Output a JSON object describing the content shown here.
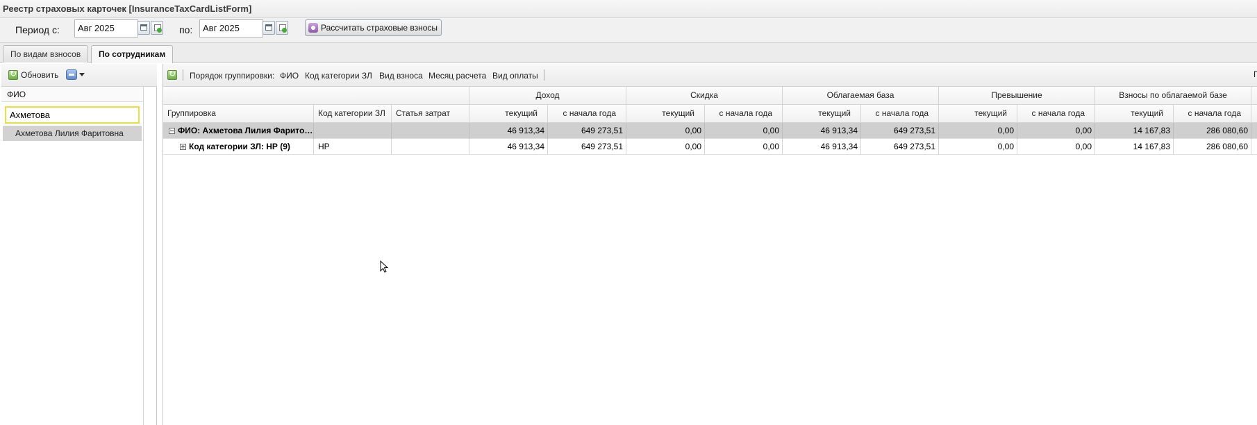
{
  "window": {
    "title": "Реестр страховых карточек [InsuranceTaxCardListForm]"
  },
  "period": {
    "from_label": "Период с:",
    "from_value": "Авг 2025",
    "to_label": "по:",
    "to_value": "Авг 2025",
    "calculate_label": "Рассчитать страховые взносы"
  },
  "tabs": [
    {
      "label": "По видам взносов",
      "active": false
    },
    {
      "label": "По сотрудникам",
      "active": true
    }
  ],
  "left": {
    "refresh_label": "Обновить",
    "column_header": "ФИО",
    "filter_value": "Ахметова",
    "employees": [
      "Ахметова Лилия Фаритовна"
    ]
  },
  "toolbar": {
    "grouping_label": "Порядок группировки:",
    "grouping_items": [
      "ФИО",
      "Код категории ЗЛ",
      "Вид взноса",
      "Месяц расчета",
      "Вид оплаты"
    ],
    "edge_text": "П"
  },
  "grid": {
    "headers": {
      "grouping": "Группировка",
      "category_code": "Код категории ЗЛ",
      "cost_item": "Статья затрат",
      "groups": [
        "Доход",
        "Скидка",
        "Облагаемая база",
        "Превышение",
        "Взносы по облагаемой базе"
      ],
      "current": "текущий",
      "ytd": "с начала года"
    },
    "rows": [
      {
        "type": "group",
        "grouping": "ФИО: Ахметова Лилия Фаритовна",
        "category_code": "",
        "cost_item": "",
        "values": [
          "46 913,34",
          "649 273,51",
          "0,00",
          "0,00",
          "46 913,34",
          "649 273,51",
          "0,00",
          "0,00",
          "14 167,83",
          "286 080,60"
        ]
      },
      {
        "type": "sub",
        "grouping": "Код категории ЗЛ: НР (9)",
        "category_code": "НР",
        "cost_item": "",
        "values": [
          "46 913,34",
          "649 273,51",
          "0,00",
          "0,00",
          "46 913,34",
          "649 273,51",
          "0,00",
          "0,00",
          "14 167,83",
          "286 080,60"
        ]
      }
    ]
  },
  "colors": {
    "selected_row": "#d2d2d2",
    "group_row": "#cfcfcf",
    "filter_border": "#e6e23a"
  }
}
